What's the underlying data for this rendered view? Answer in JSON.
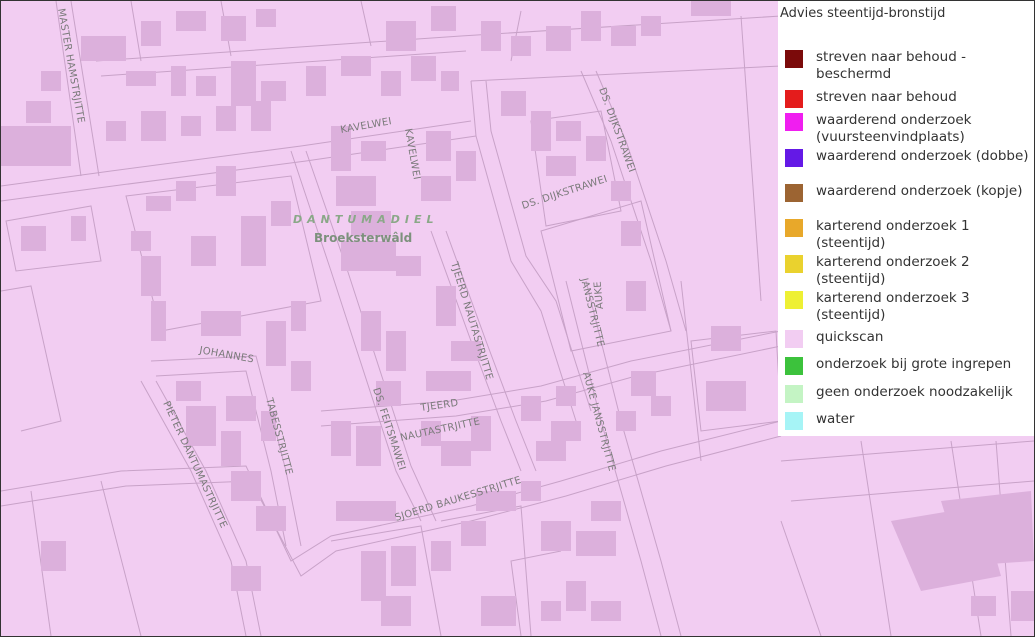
{
  "legend": {
    "title": "Advies steentijd-bronstijd",
    "items": [
      {
        "label": "streven naar behoud - beschermd",
        "color": "#7b0a0a"
      },
      {
        "label": "streven naar behoud",
        "color": "#e41c1c"
      },
      {
        "label": "waarderend onderzoek (vuursteenvindplaats)",
        "color": "#f01ef0"
      },
      {
        "label": "waarderend onderzoek (dobbe)",
        "color": "#6419e6"
      },
      {
        "label": "waarderend onderzoek (kopje)",
        "color": "#9c6432"
      },
      {
        "label": "karterend onderzoek 1 (steentijd)",
        "color": "#e8a82a"
      },
      {
        "label": "karterend onderzoek 2 (steentijd)",
        "color": "#ead22e"
      },
      {
        "label": "karterend onderzoek 3 (steentijd)",
        "color": "#eef034"
      },
      {
        "label": "quickscan",
        "color": "#f2cdf2"
      },
      {
        "label": "onderzoek bij grote ingrepen",
        "color": "#3cc23c"
      },
      {
        "label": "geen onderzoek noodzakelijk",
        "color": "#c4f4c4"
      },
      {
        "label": "water",
        "color": "#a6f4f6"
      }
    ]
  },
  "map": {
    "fill_color": "#f2cdf2",
    "place_name": "DANTUMADIEL",
    "locality": "Broeksterwâld",
    "streets": {
      "master_hamstra": "MASTER HAMSTRJITTE",
      "kavelwei_h": "KAVELWEI",
      "kavelwei_v": "KAVELWEI",
      "ds_dijkstrawei_v": "DS. DIJKSTRAWEI",
      "ds_dijkstrawei_h": "DS. DIJKSTRAWEI",
      "tjeerd_nauta_v": "TJEERD NAUTASTRJITTE",
      "tjeerd_h1": "TJEERD",
      "tjeerd_h2": "NAUTASTRJITTE",
      "auke_jans_short": "AUKE",
      "jans_short": "JANSSTRJITTE",
      "auke_jans_long": "AUKE JANSSTRJITTE",
      "johannes": "JOHANNES",
      "tabes": "TABESSTRJITTE",
      "pieter_dantuma": "PIETER DANTUMASTRJITTE",
      "ds_feitsma": "DS. FEITSMAWEI",
      "sjoerd_baukes": "SJOERD BAUKESSTRJITTE"
    }
  }
}
